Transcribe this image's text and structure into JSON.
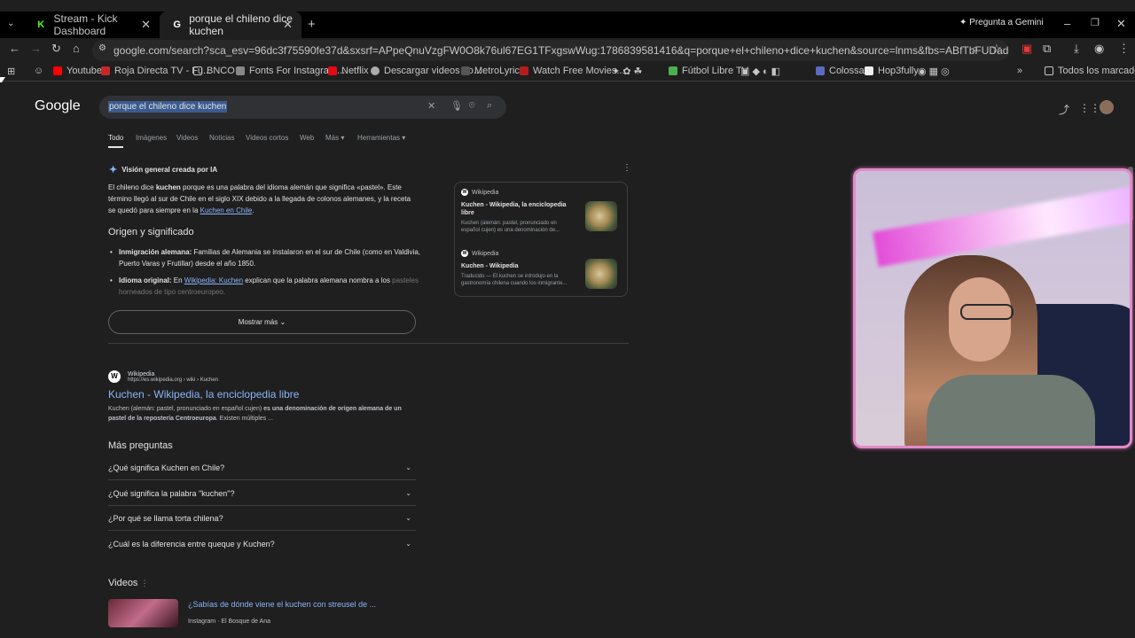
{
  "tabs": [
    {
      "label": "Stream - Kick Dashboard",
      "icon": "kick-icon"
    },
    {
      "label": "porque el chileno dice kuchen",
      "icon": "google-icon"
    }
  ],
  "gemini": "Pregunta a Gemini",
  "url": "google.com/search?sca_esv=96dc3f75590fe37d&sxsrf=APpeQnuVzgFW0O8k76ul67EG1TFxgswWug:1786839581416&q=porque+el+chileno+dice+kuchen&source=lnms&fbs=ABfTbFUDadgeu2mn4mYJ8iEZ1GUDd8ABuXxNzQEfi5TS...",
  "bookmarks": [
    {
      "label": "Youtube",
      "color": "#ff0000"
    },
    {
      "label": "Roja Directa TV - Fu...",
      "color": "#c62828"
    },
    {
      "label": "BNCO",
      "color": "#c7c7c7"
    },
    {
      "label": "Fonts For Instagram...",
      "color": "#888"
    },
    {
      "label": "Netflix",
      "color": "#e50914"
    },
    {
      "label": "Descargar videos Yo...",
      "color": "#aaa"
    },
    {
      "label": "MetroLyrics",
      "color": "#555"
    },
    {
      "label": "Watch Free Movies...",
      "color": "#b71c1c"
    },
    {
      "label": "Fútbol Libre TV",
      "color": "#4caf50"
    },
    {
      "label": "Colossal",
      "color": "#5c6bc0"
    },
    {
      "label": "Hop3fully",
      "color": "#eee"
    },
    {
      "label": "Todos los marcadores",
      "color": "#c7c7c7"
    }
  ],
  "search": {
    "logo": "Google",
    "query": "porque el chileno dice kuchen",
    "filters": [
      "Todo",
      "Imágenes",
      "Videos",
      "Noticias",
      "Videos cortos",
      "Web",
      "Más ▾",
      "Herramientas ▾"
    ]
  },
  "ai": {
    "title": "Visión general creada por IA",
    "intro_a": "El chileno dice ",
    "intro_b": "kuchen",
    "intro_c": " porque es una palabra del idioma alemán que significa «pastel». Este término llegó al sur de Chile en el siglo XIX debido a la llegada de colonos alemanes, y la receta se quedó para siempre en la ",
    "intro_link": "Kuchen en Chile",
    "intro_d": ".",
    "section": "Origen y significado",
    "b1_bold": "Inmigración alemana:",
    "b1_text": " Familias de Alemania se instalaron en el sur de Chile (como en Valdivia, Puerto Varas y Frutillar) desde el año 1850.",
    "b2_bold": "Idioma original:",
    "b2_text_a": " En ",
    "b2_link": "Wikipedia: Kuchen",
    "b2_text_b": " explican que la palabra alemana nombra a los ",
    "b2_fade": "pasteles horneados de tipo centroeuropeo.",
    "more": "Mostrar más"
  },
  "sources": [
    {
      "site": "Wikipedia",
      "title": "Kuchen - Wikipedia, la enciclopedia libre",
      "snippet": "Kuchen (alemán: pastel, pronunciado en español cujen) es una denominación de..."
    },
    {
      "site": "Wikipedia",
      "title": "Kuchen - Wikipedia",
      "snippet": "Traducido — El kuchen se introdujo en la gastronomía chilena cuando los inmigrante..."
    }
  ],
  "result": {
    "site": "Wikipedia",
    "url": "https://es.wikipedia.org › wiki › Kuchen",
    "title": "Kuchen - Wikipedia, la enciclopedia libre",
    "snippet_a": "Kuchen (alemán: pastel, pronunciado en español cujen) ",
    "snippet_b": "es una denominación de origen alemana de un pastel de la repostería Centroeuropa",
    "snippet_c": ". Existen múltiples ..."
  },
  "paa": {
    "title": "Más preguntas",
    "items": [
      "¿Qué significa Kuchen en Chile?",
      "¿Qué significa la palabra \"kuchen\"?",
      "¿Por qué se llama torta chilena?",
      "¿Cuál es la diferencia entre queque y Kuchen?"
    ]
  },
  "videos": {
    "title": "Videos",
    "first_title": "¿Sabías de dónde viene el kuchen con streusel de ...",
    "first_meta": "Instagram · El Bosque de Ana"
  }
}
